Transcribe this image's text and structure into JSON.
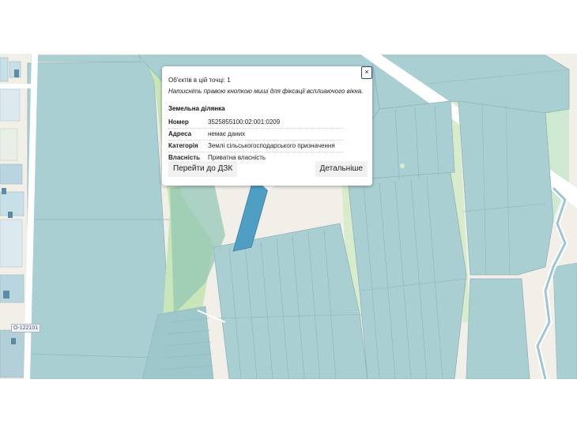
{
  "map": {
    "road_label": "O-122101",
    "colors": {
      "parcel_fill": "#a9cfd2",
      "parcel_dark": "#9dc7cb",
      "parcel_stroke": "#8fb4b9",
      "selected_parcel": "#4f9ec4",
      "green_strip": "#c9e6b8",
      "road": "#ffffff",
      "background": "#f2efe9",
      "water": "#9fc5d3"
    }
  },
  "popup": {
    "close_label": "×",
    "objects_count": "Об'єктів в цій точці: 1",
    "hint": "Натисніть правою кнопкою миші для фіксації всплиаючого вікна.",
    "section_title": "Земельна ділянка",
    "rows": [
      {
        "key": "Номер",
        "value": "3525855100:02:001:0209"
      },
      {
        "key": "Адреса",
        "value": "немає даних"
      },
      {
        "key": "Категорія",
        "value": "Землі сільськогосподарського призначення"
      },
      {
        "key": "Власність",
        "value": "Приватна власність"
      }
    ],
    "btn_dzk": "Перейти до ДЗК",
    "btn_details": "Детальніше"
  }
}
